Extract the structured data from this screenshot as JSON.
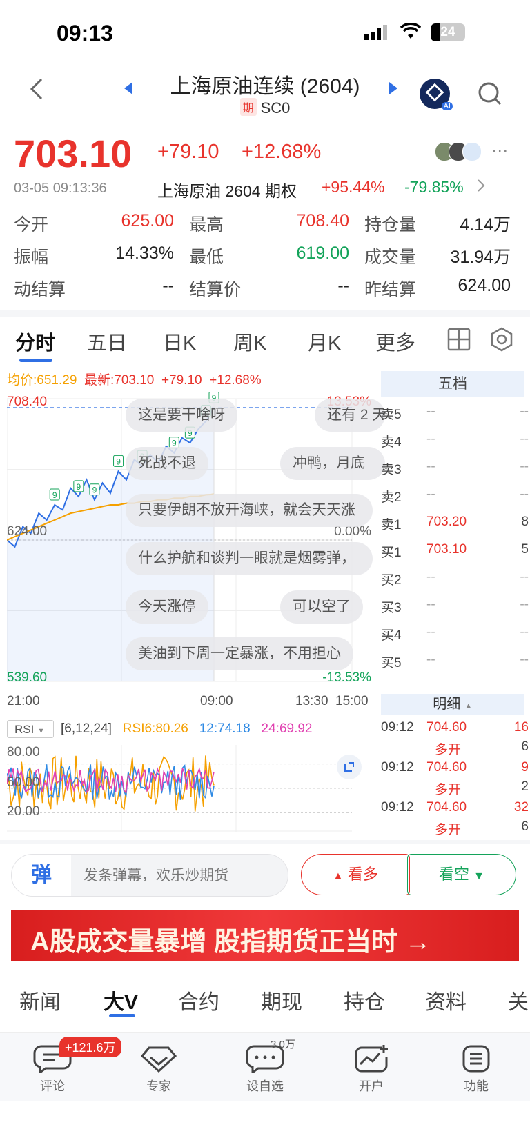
{
  "status": {
    "time": "09:13",
    "battery": "24"
  },
  "header": {
    "title": "上海原油连续 (2604)",
    "badge": "期",
    "subtitle": "SC0",
    "ai_label": "AI"
  },
  "quote": {
    "price": "703.10",
    "change": "+79.10",
    "pct": "+12.68%",
    "datetime": "03-05 09:13:36",
    "option_name": "上海原油 2604 期权",
    "option_up": "+95.44%",
    "option_down": "-79.85%"
  },
  "stats": [
    [
      {
        "label": "今开",
        "value": "625.00",
        "color": "red"
      },
      {
        "label": "最高",
        "value": "708.40",
        "color": "red"
      },
      {
        "label": "持仓量",
        "value": "4.14万",
        "color": "dark"
      }
    ],
    [
      {
        "label": "振幅",
        "value": "14.33%",
        "color": "dark"
      },
      {
        "label": "最低",
        "value": "619.00",
        "color": "green"
      },
      {
        "label": "成交量",
        "value": "31.94万",
        "color": "dark"
      }
    ],
    [
      {
        "label": "动结算",
        "value": "--",
        "color": "dark"
      },
      {
        "label": "结算价",
        "value": "--",
        "color": "dark"
      },
      {
        "label": "昨结算",
        "value": "624.00",
        "color": "dark"
      }
    ]
  ],
  "tabs": [
    "分时",
    "五日",
    "日K",
    "周K",
    "月K",
    "更多"
  ],
  "chart_info": {
    "avg": "均价:651.29",
    "latest": "最新:703.10",
    "chg": "+79.10",
    "pct": "+12.68%"
  },
  "chart_data": {
    "type": "line",
    "series": [
      {
        "values": [
          624,
          620,
          632,
          628,
          640,
          636,
          645,
          642,
          655,
          650,
          660,
          648,
          658,
          652,
          665,
          660,
          672,
          668,
          675,
          670,
          680,
          676,
          685,
          682,
          690,
          695,
          703
        ]
      },
      {
        "values": [
          624,
          626,
          628,
          630,
          632,
          634,
          636,
          638,
          640,
          641,
          642,
          643,
          644,
          645,
          645,
          646,
          646,
          647,
          647,
          648,
          648,
          649,
          649,
          650,
          650,
          651,
          651.29
        ]
      }
    ],
    "y_labels": {
      "top": "708.40",
      "mid": "624.00",
      "bottom": "539.60",
      "top_pct": "13.53%",
      "mid_pct": "0.00%",
      "bottom_pct": "-13.53%"
    },
    "x_labels": [
      "21:00",
      "09:00",
      "13:30",
      "15:00"
    ]
  },
  "bubbles": [
    "这是要干啥呀",
    "还有 2 天",
    "死战不退",
    "冲鸭，月底",
    "只要伊朗不放开海峡，就会天天涨",
    "什么护航和谈判一眼就是烟雾弹，",
    "今天涨停",
    "可以空了",
    "美油到下周一定暴涨，不用担心"
  ],
  "markers": [
    "9",
    "9",
    "9",
    "9",
    "9",
    "9",
    "9",
    "9",
    "9"
  ],
  "rsi": {
    "label": "RSI",
    "params": "[6,12,24]",
    "rsi6": "RSI6:80.26",
    "rsi12": "12:74.18",
    "rsi24": "24:69.92",
    "levels": [
      "80.00",
      "50.00",
      "20.00"
    ]
  },
  "orderbook": {
    "title": "五档",
    "rows": [
      {
        "side": "卖5",
        "price": "--",
        "vol": "--"
      },
      {
        "side": "卖4",
        "price": "--",
        "vol": "--"
      },
      {
        "side": "卖3",
        "price": "--",
        "vol": "--"
      },
      {
        "side": "卖2",
        "price": "--",
        "vol": "--"
      },
      {
        "side": "卖1",
        "price": "703.20",
        "vol": "8"
      },
      {
        "side": "买1",
        "price": "703.10",
        "vol": "5"
      },
      {
        "side": "买2",
        "price": "--",
        "vol": "--"
      },
      {
        "side": "买3",
        "price": "--",
        "vol": "--"
      },
      {
        "side": "买4",
        "price": "--",
        "vol": "--"
      },
      {
        "side": "买5",
        "price": "--",
        "vol": "--"
      }
    ]
  },
  "detail": {
    "title": "明细",
    "rows": [
      {
        "time": "09:12",
        "price": "704.60",
        "vol": "16",
        "type": "多开",
        "sub": "6"
      },
      {
        "time": "09:12",
        "price": "704.60",
        "vol": "9",
        "type": "多开",
        "sub": "2"
      },
      {
        "time": "09:12",
        "price": "704.60",
        "vol": "32",
        "type": "多开",
        "sub": "6"
      }
    ]
  },
  "danmu": {
    "icon": "弹",
    "placeholder": "发条弹幕，欢乐炒期货",
    "bull": "看多",
    "bear": "看空"
  },
  "banner": {
    "text": "A股成交量暴增 股指期货正当时 →"
  },
  "news_tabs": [
    "新闻",
    "大V",
    "合约",
    "期现",
    "持仓",
    "资料",
    "关"
  ],
  "bottom_nav": [
    {
      "label": "评论",
      "badge": "+121.6万"
    },
    {
      "label": "专家",
      "badge": ""
    },
    {
      "label": "设自选",
      "badge": "3.0万"
    },
    {
      "label": "开户",
      "badge": ""
    },
    {
      "label": "功能",
      "badge": ""
    }
  ],
  "colors": {
    "red": "#e8332c",
    "green": "#14a35a",
    "blue": "#2f6fe4",
    "orange": "#f5a000"
  }
}
